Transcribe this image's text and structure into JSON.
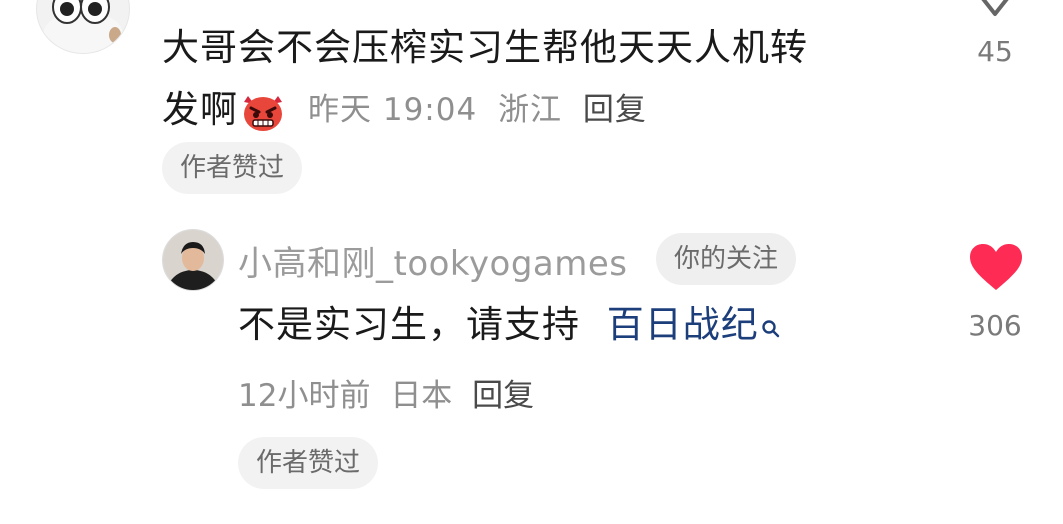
{
  "main_comment": {
    "text_line1": "大哥会不会压榨实习生帮他天天人机转",
    "text_line2": "发啊",
    "emoji": "angry-devil-emoji",
    "time": "昨天 19:04",
    "location": "浙江",
    "reply_label": "回复",
    "author_liked_chip": "作者赞过",
    "like_count": "45"
  },
  "reply_comment": {
    "username": "小高和刚_tookyogames",
    "follow_badge": "你的关注",
    "text_plain": "不是实习生，请支持",
    "text_link": "百日战纪",
    "time": "12小时前",
    "location": "日本",
    "reply_label": "回复",
    "author_liked_chip": "作者赞过",
    "like_count": "306",
    "like_color": "#fe2c55"
  }
}
